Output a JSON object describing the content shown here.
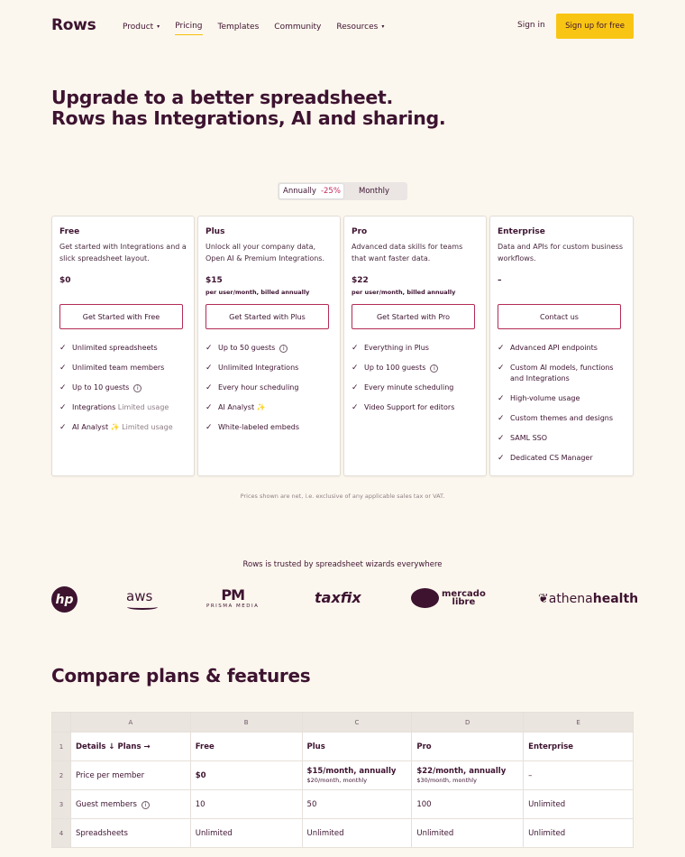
{
  "nav": {
    "logo": "Rows",
    "links": [
      {
        "label": "Product",
        "dropdown": true
      },
      {
        "label": "Pricing",
        "active": true
      },
      {
        "label": "Templates"
      },
      {
        "label": "Community"
      },
      {
        "label": "Resources",
        "dropdown": true
      }
    ],
    "signin": "Sign in",
    "signup": "Sign up for free",
    "colors": {
      "accent": "#f9c514",
      "brand": "#3d1330"
    }
  },
  "hero": {
    "line1": "Upgrade to a better spreadsheet.",
    "line2": "Rows has Integrations, AI and sharing."
  },
  "billing": {
    "annual_label": "Annually",
    "annual_discount": "-25%",
    "monthly_label": "Monthly",
    "selected": "Annually"
  },
  "plans": [
    {
      "name": "Free",
      "desc": "Get started with Integrations and a slick spreadsheet layout.",
      "price": "$0",
      "per": "",
      "button": "Get Started with Free",
      "features": [
        {
          "text": "Unlimited spreadsheets"
        },
        {
          "text": "Unlimited team members"
        },
        {
          "text": "Up to 10 guests",
          "info": true
        },
        {
          "text": "Integrations",
          "muted": "Limited usage"
        },
        {
          "text": "AI Analyst",
          "spark": "✨",
          "muted": "Limited usage"
        }
      ]
    },
    {
      "name": "Plus",
      "desc": "Unlock all your company data, Open AI & Premium Integrations.",
      "price": "$15",
      "per": "per user/month, billed annually",
      "button": "Get Started with Plus",
      "features": [
        {
          "text": "Up to 50 guests",
          "info": true
        },
        {
          "text": "Unlimited Integrations"
        },
        {
          "text": "Every hour scheduling"
        },
        {
          "text": "AI Analyst",
          "spark": "✨"
        },
        {
          "text": "White-labeled embeds"
        }
      ]
    },
    {
      "name": "Pro",
      "desc": "Advanced data skills for teams that want faster data.",
      "price": "$22",
      "per": "per user/month, billed annually",
      "button": "Get Started with Pro",
      "features": [
        {
          "text": "Everything in Plus"
        },
        {
          "text": "Up to 100 guests",
          "info": true
        },
        {
          "text": "Every minute scheduling"
        },
        {
          "text": "Video Support for editors"
        }
      ]
    },
    {
      "name": "Enterprise",
      "desc": "Data and APIs for custom business workflows.",
      "price": "–",
      "per": "",
      "button": "Contact us",
      "features": [
        {
          "text": "Advanced API endpoints"
        },
        {
          "text": "Custom AI models, functions and Integrations"
        },
        {
          "text": "High-volume usage"
        },
        {
          "text": "Custom themes and designs"
        },
        {
          "text": "SAML SSO"
        },
        {
          "text": "Dedicated CS Manager"
        }
      ]
    }
  ],
  "note": "Prices shown are net, i.e. exclusive of any applicable sales tax or VAT.",
  "trusted": {
    "title": "Rows is trusted by spreadsheet wizards everywhere",
    "logos": {
      "hp": "hp",
      "aws": "aws",
      "pm_big": "PM",
      "pm_small": "PRISMA MEDIA",
      "taxfix": "taxfix",
      "mercado_1": "mercado",
      "mercado_2": "libre",
      "athena_pre": "athena",
      "athena_post": "health"
    }
  },
  "compare": {
    "title": "Compare plans & features",
    "columns": [
      "A",
      "B",
      "C",
      "D",
      "E"
    ],
    "rows": [
      {
        "num": "1",
        "cells": [
          "Details ↓ Plans →",
          "Free",
          "Plus",
          "Pro",
          "Enterprise"
        ]
      },
      {
        "num": "2",
        "cells": [
          "Price per member",
          "$0",
          "$15/month, annually",
          "$22/month, annually",
          "–"
        ],
        "subs": [
          "",
          "",
          "$20/month, monthly",
          "$30/month, monthly",
          ""
        ]
      },
      {
        "num": "3",
        "cells": [
          "Guest members",
          "10",
          "50",
          "100",
          "Unlimited"
        ]
      },
      {
        "num": "4",
        "cells": [
          "Spreadsheets",
          "Unlimited",
          "Unlimited",
          "Unlimited",
          "Unlimited"
        ]
      }
    ]
  }
}
